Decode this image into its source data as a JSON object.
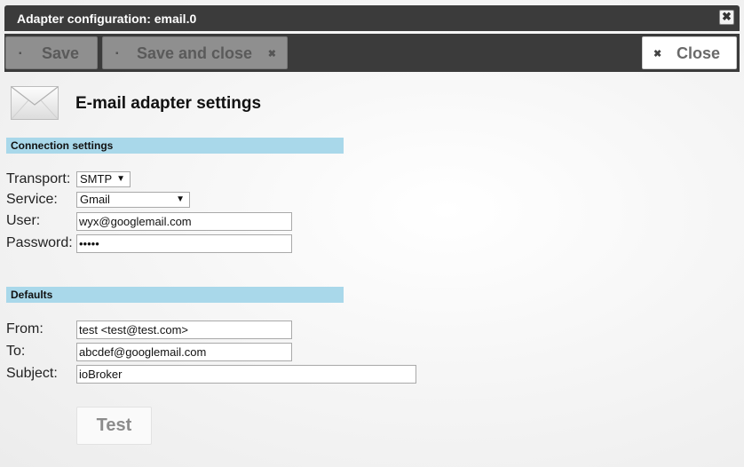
{
  "window": {
    "title": "Adapter configuration: email.0",
    "close_glyph": "✖"
  },
  "toolbar": {
    "save_label": "Save",
    "save_close_label": "Save and close",
    "close_label": "Close",
    "save_icon": "floppy-icon",
    "close_icon": "x-icon"
  },
  "header": {
    "title": "E-mail adapter settings",
    "icon": "envelope-icon"
  },
  "connection": {
    "section_title": "Connection settings",
    "transport_label": "Transport:",
    "transport_value": "SMTP",
    "service_label": "Service:",
    "service_value": "Gmail",
    "user_label": "User:",
    "user_value": "wyx@googlemail.com",
    "password_label": "Password:",
    "password_value": "•••••"
  },
  "defaults": {
    "section_title": "Defaults",
    "from_label": "From:",
    "from_value": "test <test@test.com>",
    "to_label": "To:",
    "to_value": "abcdef@googlemail.com",
    "subject_label": "Subject:",
    "subject_value": "ioBroker"
  },
  "test_button": {
    "label": "Test"
  },
  "colors": {
    "titlebar": "#3b3b3b",
    "section_bar": "#a9d8ea",
    "disabled_button": "#8f8f8f"
  }
}
